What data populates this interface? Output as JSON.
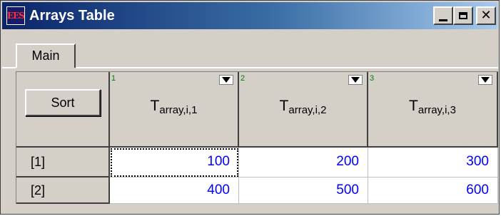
{
  "window": {
    "title": "Arrays Table",
    "icon_letters": "EES",
    "icon": "ees-app-icon",
    "buttons": {
      "minimize": "minimize-icon",
      "maximize": "maximize-icon",
      "close_glyph": "✕"
    }
  },
  "tabs": [
    {
      "label": "Main",
      "selected": true
    }
  ],
  "table": {
    "sort_label": "Sort",
    "columns": [
      {
        "number": "1",
        "base": "T",
        "subscript": "array,i,1"
      },
      {
        "number": "2",
        "base": "T",
        "subscript": "array,i,2"
      },
      {
        "number": "3",
        "base": "T",
        "subscript": "array,i,3"
      }
    ],
    "rows": [
      {
        "label": "[1]",
        "values": [
          "100",
          "200",
          "300"
        ]
      },
      {
        "label": "[2]",
        "values": [
          "400",
          "500",
          "600"
        ]
      }
    ],
    "colors": {
      "value_text": "#0000ff",
      "column_number": "#008000",
      "title_bar_start": "#0a246a"
    }
  }
}
